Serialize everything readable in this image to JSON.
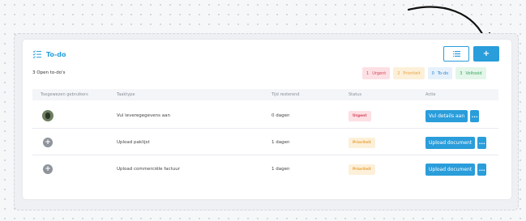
{
  "todo": {
    "title": "To-do",
    "open_count": "3 Open to-do's",
    "add_label": "+",
    "badges": [
      {
        "count": "1",
        "label": "Urgent"
      },
      {
        "count": "2",
        "label": "Prioriteit"
      },
      {
        "count": "0",
        "label": "To-do"
      },
      {
        "count": "3",
        "label": "Voltooid"
      }
    ],
    "columns": [
      "Toegewezen gebruikers",
      "Taaktype",
      "Tijd resterend",
      "Status",
      "Actie"
    ],
    "rows": [
      {
        "assignee": "avatar",
        "task": "Vul leveregegevens aan",
        "time": "0 dagen",
        "status": "Urgent",
        "action": "Vul details aan",
        "more": "..."
      },
      {
        "assignee": "+",
        "task": "Upload paklijst",
        "time": "1 dagen",
        "status": "Prioriteit",
        "action": "Upload document",
        "more": "..."
      },
      {
        "assignee": "+",
        "task": "Upload commerciële factuur",
        "time": "1 dagen",
        "status": "Prioriteit",
        "action": "Upload document",
        "more": "..."
      }
    ]
  },
  "colors": {
    "accent": "#2a9ddb",
    "urgent": "#d6455c",
    "priority": "#e6a33c",
    "todo": "#2a86d0",
    "done": "#3aa35c"
  },
  "icons": {
    "title": "checklist-icon",
    "list_button": "list-icon",
    "annotation": "curved-arrow-icon"
  }
}
